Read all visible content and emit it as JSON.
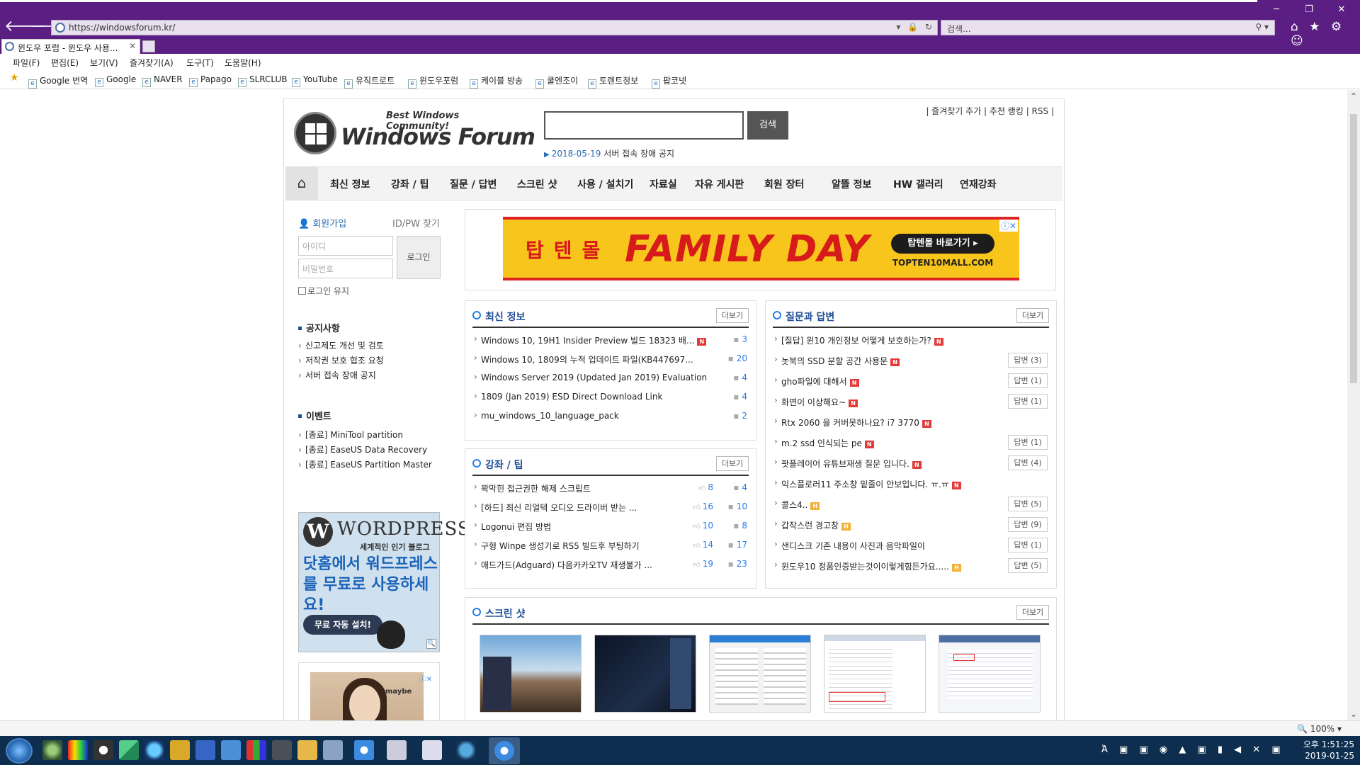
{
  "browser": {
    "url": "https://windowsforum.kr/",
    "search_placeholder": "검색...",
    "tab_title": "윈도우 포럼 - 윈도우 사용...",
    "tab_close": "✕",
    "window_controls": {
      "minimize": "─",
      "restore": "❐",
      "close": "✕"
    },
    "nav": {
      "back": "🡐",
      "forward": "🡒"
    },
    "addr_tools": "▾ 🔒 ↻",
    "search_tool": "⚲ ▾",
    "right_icons": "⌂ ★ ⚙ ☺",
    "menu": [
      "파일(F)",
      "편집(E)",
      "보기(V)",
      "즐겨찾기(A)",
      "도구(T)",
      "도움말(H)"
    ],
    "favorites": [
      "Google 번역",
      "Google",
      "NAVER",
      "Papago",
      "SLRCLUB",
      "YouTube",
      "유직트로트",
      "윈도우포럼",
      "케이블 방송",
      "쿨엔조이",
      "토렌트정보",
      "팝코넷"
    ],
    "fav_star": "★",
    "zoom": "🔍 100%  ▾",
    "scroll_up": "⌃",
    "scroll_down": "⌄"
  },
  "site": {
    "tagline": "Best Windows Community!",
    "logo_text": "Windows Forum",
    "search_button": "검색",
    "notice_arrow": "▶",
    "notice_date": "2018-05-19",
    "notice_text": "서버 접속 장애 공지",
    "top_links": "| 즐겨찾기 추가 | 추천 랭킹 | RSS |",
    "home_icon": "⌂",
    "nav": [
      "최신 정보",
      "강좌 / 팁",
      "질문 / 답변",
      "스크린 샷",
      "사용 / 설치기",
      "자료실",
      "자유 게시판",
      "회원 장터",
      "알뜰 정보",
      "HW 갤러리",
      "연재강좌"
    ]
  },
  "login": {
    "join": "👤 회원가입",
    "find": "ID/PW 찾기",
    "id_placeholder": "아이디",
    "pw_placeholder": "비밀번호",
    "button": "로그인",
    "keep": "로그인 유지"
  },
  "sidebar": {
    "notice_title": "공지사항",
    "notices": [
      "신고제도 개선 및 검토",
      "저작권 보호 협조 요청",
      "서버 접속 장애 공지"
    ],
    "event_title": "이벤트",
    "events": [
      "[종료] MiniTool partition",
      "[종료] EaseUS Data Recovery",
      "[종료] EaseUS Partition Master"
    ]
  },
  "wp_ad": {
    "logo": "W",
    "name": "WORDPRESS",
    "sub": "세계적인 인기 블로그",
    "main": "닷홈에서 워드프레스를 무료로 사용하세요!",
    "button": "무료 자동 설치!",
    "zoom_icon": "🔍"
  },
  "side_ad": {
    "brand": "maybe",
    "close": "ⓘ✕"
  },
  "banner": {
    "brand": "탑텐몰",
    "headline": "FAMILY DAY",
    "cta": "탑텐몰 바로가기 ▸",
    "url": "TOPTEN10MALL.COM",
    "close": "ⓘ✕"
  },
  "more_label": "더보기",
  "latest": {
    "title": "최신 정보",
    "posts": [
      {
        "title": "Windows 10, 19H1 Insider Preview 빌드 18323 배...",
        "new": true,
        "comments": "3"
      },
      {
        "title": "Windows 10, 1809의 누적 업데이트 파일(KB447697...",
        "new": false,
        "comments": "20"
      },
      {
        "title": "Windows Server 2019 (Updated Jan 2019) Evaluation",
        "new": false,
        "comments": "4"
      },
      {
        "title": "1809 (Jan 2019) ESD Direct Download Link",
        "new": false,
        "comments": "4"
      },
      {
        "title": "mu_windows_10_language_pack",
        "new": false,
        "comments": "2"
      }
    ]
  },
  "tips": {
    "title": "강좌 / 팁",
    "posts": [
      {
        "title": "꽉막힌 접근권한 해제 스크립트",
        "likes": "8",
        "comments": "4"
      },
      {
        "title": "[하드] 최신 리얼텍 오디오 드라이버 받는 ...",
        "likes": "16",
        "comments": "10"
      },
      {
        "title": "Logonui 편집 방법",
        "likes": "10",
        "comments": "8"
      },
      {
        "title": "구형 Winpe 생성기로 RS5 빌드후 부팅하기",
        "likes": "14",
        "comments": "17"
      },
      {
        "title": "애드가드(Adguard) 다음카카오TV 재생불가 ...",
        "likes": "19",
        "comments": "23"
      }
    ]
  },
  "qna": {
    "title": "질문과 답변",
    "posts": [
      {
        "title": "[질답] 윈10 개인정보 어떻게 보호하는가?",
        "badge": "new",
        "answer": ""
      },
      {
        "title": "놋북의 SSD 분할 공간 사용문",
        "badge": "new",
        "answer": "답변 (3)"
      },
      {
        "title": "gho파일에 대해서",
        "badge": "new",
        "answer": "답변 (1)"
      },
      {
        "title": "화면이 이상해요~",
        "badge": "new",
        "answer": "답변 (1)"
      },
      {
        "title": "Rtx 2060 을 커버못하나요? i7 3770",
        "badge": "new",
        "answer": ""
      },
      {
        "title": "m.2 ssd 인식되는 pe",
        "badge": "new",
        "answer": "답변 (1)"
      },
      {
        "title": "팟플레이어 유튜브재생 질문 입니다.",
        "badge": "new",
        "answer": "답변 (4)"
      },
      {
        "title": "익스플로러11 주소창 밑줄이 안보입니다. ㅠ.ㅠ",
        "badge": "new",
        "answer": ""
      },
      {
        "title": "콜스4..",
        "badge": "hot",
        "answer": "답변 (5)"
      },
      {
        "title": "갑작스런 경고창",
        "badge": "hot",
        "answer": "답변 (9)"
      },
      {
        "title": "샌디스크 기존 내용이 사진과 음악파일이",
        "badge": "",
        "answer": "답변 (1)"
      },
      {
        "title": "윈도우10 정품인증받는것이이렇게힘든가요.....",
        "badge": "hot",
        "answer": "답변 (5)"
      }
    ]
  },
  "screens": {
    "title": "스크린 샷"
  },
  "taskbar": {
    "tray": "Ἀ ▣ ▣ ◉ ▲ ▣ ▮ ◀ ✕ ▣",
    "time": "오후 1:51:25",
    "date": "2019-01-25"
  }
}
